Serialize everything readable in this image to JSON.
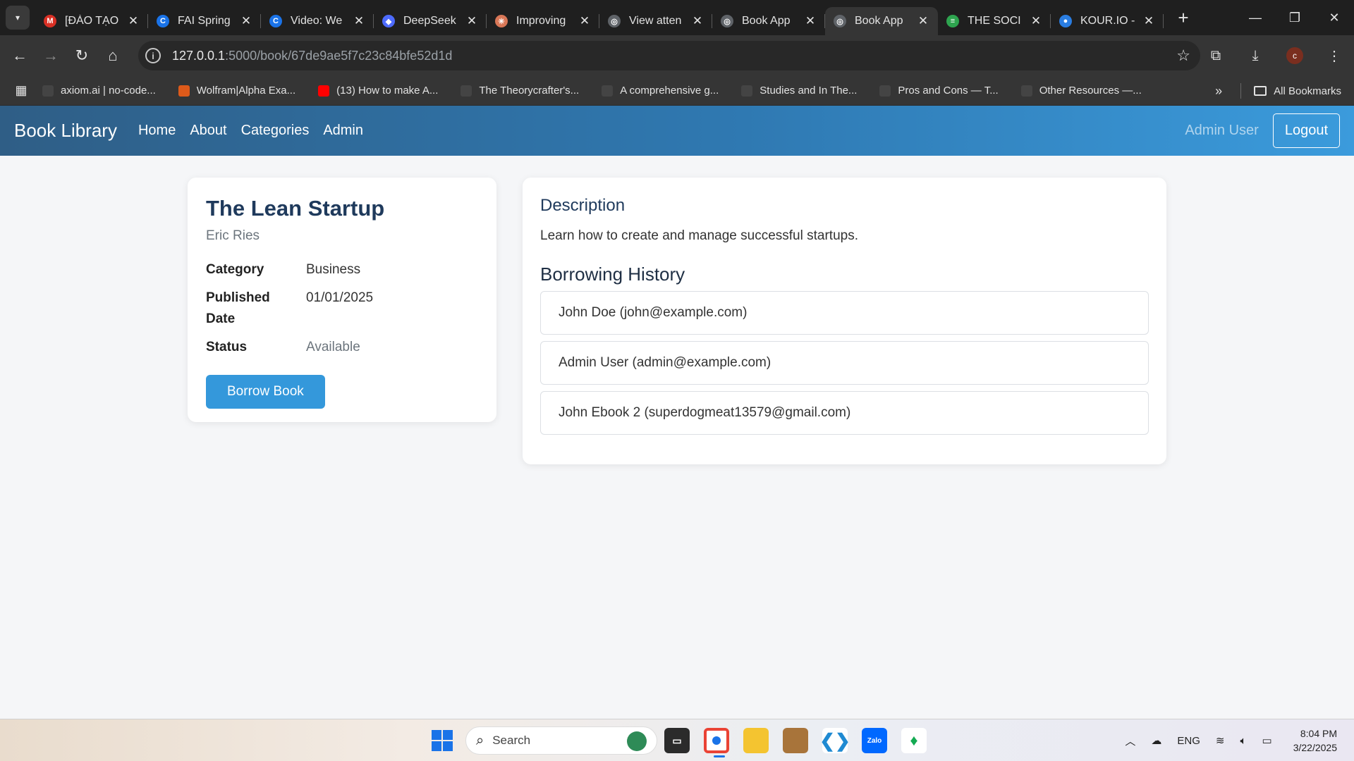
{
  "browser": {
    "tabs": [
      {
        "title": "[ĐÀO TẠO",
        "icon": "gmail-icon",
        "color": "#d93025",
        "glyph": "M"
      },
      {
        "title": "FAI Spring",
        "icon": "c-icon",
        "color": "#1a73e8",
        "glyph": "C"
      },
      {
        "title": "Video: We",
        "icon": "c-icon",
        "color": "#1a73e8",
        "glyph": "C"
      },
      {
        "title": "DeepSeek",
        "icon": "deepseek-icon",
        "color": "#4d6bfe",
        "glyph": "◆"
      },
      {
        "title": "Improving",
        "icon": "claude-icon",
        "color": "#d97757",
        "glyph": "✳"
      },
      {
        "title": "View atten",
        "icon": "globe-icon",
        "color": "#5f6368",
        "glyph": "◎"
      },
      {
        "title": "Book App",
        "icon": "globe-icon",
        "color": "#5f6368",
        "glyph": "◎"
      },
      {
        "title": "Book App",
        "icon": "globe-icon",
        "color": "#5f6368",
        "glyph": "◎",
        "active": true
      },
      {
        "title": "THE SOCI",
        "icon": "stack-icon",
        "color": "#2ea44f",
        "glyph": "≡"
      },
      {
        "title": "KOUR.IO -",
        "icon": "kour-icon",
        "color": "#2a7de1",
        "glyph": "●"
      }
    ],
    "url_host": "127.0.0.1",
    "url_path": ":5000/book/67de9ae5f7c23c84bfe52d1d",
    "profile_initial": "c",
    "bookmarks": [
      {
        "label": "axiom.ai | no-code...",
        "color": "#444"
      },
      {
        "label": "Wolfram|Alpha Exa...",
        "color": "#dd5a1a"
      },
      {
        "label": "(13) How to make A...",
        "color": "#ff0000"
      },
      {
        "label": "The Theorycrafter's...",
        "color": "#444"
      },
      {
        "label": "A comprehensive g...",
        "color": "#444"
      },
      {
        "label": "Studies and In The...",
        "color": "#444"
      },
      {
        "label": "Pros and Cons — T...",
        "color": "#444"
      },
      {
        "label": "Other Resources —...",
        "color": "#444"
      }
    ],
    "all_bookmarks": "All Bookmarks"
  },
  "site": {
    "brand": "Book Library",
    "nav": [
      "Home",
      "About",
      "Categories",
      "Admin"
    ],
    "user": "Admin User",
    "logout": "Logout",
    "accent": "#3498db"
  },
  "book": {
    "title": "The Lean Startup",
    "author": "Eric Ries",
    "category_label": "Category",
    "category": "Business",
    "published_label": "Published Date",
    "published": "01/01/2025",
    "status_label": "Status",
    "status": "Available",
    "borrow_button": "Borrow Book"
  },
  "details": {
    "description_title": "Description",
    "description": "Learn how to create and manage successful startups.",
    "history_title": "Borrowing History",
    "history": [
      "John Doe (john@example.com)",
      "Admin User (admin@example.com)",
      "John Ebook 2 (superdogmeat13579@gmail.com)"
    ]
  },
  "taskbar": {
    "search_placeholder": "Search",
    "lang": "ENG",
    "time": "8:04 PM",
    "date": "3/22/2025"
  }
}
